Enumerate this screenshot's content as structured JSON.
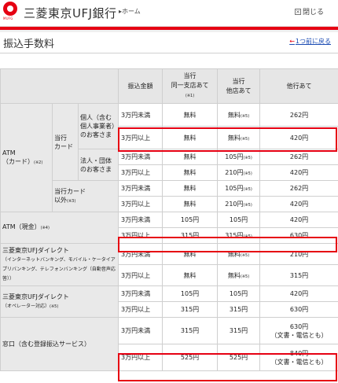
{
  "header": {
    "logo_text": "MUFG",
    "bank_name": "三菱東京UFJ銀行",
    "home_link": "▸ホーム",
    "close_icon": "×",
    "close_label": "閉じる"
  },
  "page": {
    "title": "振込手数料",
    "back_link": "1つ前に戻る"
  },
  "columns": {
    "amount": "振込金額",
    "same_branch_line1": "当行",
    "same_branch_line2": "同一支店あて",
    "same_branch_note": "(※1)",
    "other_branch_line1": "当行",
    "other_branch_line2": "他店あて",
    "other_bank": "他行あて"
  },
  "labels": {
    "atm_card": "ATM",
    "atm_card_sub": "（カード）",
    "atm_card_note": "(※2)",
    "own_card_line1": "当行",
    "own_card_line2": "カード",
    "individual": "個人（含む個人事業者）のお客さま",
    "corporate": "法人・団体のお客さま",
    "other_card_line1": "当行カード",
    "other_card_line2": "以外",
    "other_card_note": "(※3)",
    "atm_cash": "ATM（現金）",
    "atm_cash_note": "(※4)",
    "direct_title": "三菱東京UFJダイレクト",
    "direct_sub": "（インターネットバンキング、モバイル・ケータイアプリバンキング、テレフォンバンキング（自動音声応答））",
    "direct_op_title": "三菱東京UFJダイレクト",
    "direct_op_sub": "（オペレーター対応）",
    "direct_op_note": "(※5)",
    "counter": "窓口（含む登録振込サービス）"
  },
  "notes": {
    "n5": "(※5)"
  },
  "rows": [
    {
      "amount": "3万円未満",
      "same": "無料",
      "other_branch": "無料",
      "other_branch_note": "(※5)",
      "other_bank": "262円"
    },
    {
      "amount": "3万円以上",
      "same": "無料",
      "other_branch": "無料",
      "other_branch_note": "(※5)",
      "other_bank": "420円"
    },
    {
      "amount": "3万円未満",
      "same": "無料",
      "other_branch": "105円",
      "other_branch_note": "(※5)",
      "other_bank": "262円"
    },
    {
      "amount": "3万円以上",
      "same": "無料",
      "other_branch": "210円",
      "other_branch_note": "(※5)",
      "other_bank": "420円"
    },
    {
      "amount": "3万円未満",
      "same": "無料",
      "other_branch": "105円",
      "other_branch_note": "(※5)",
      "other_bank": "262円"
    },
    {
      "amount": "3万円以上",
      "same": "無料",
      "other_branch": "210円",
      "other_branch_note": "(※5)",
      "other_bank": "420円"
    },
    {
      "amount": "3万円未満",
      "same": "105円",
      "other_branch": "105円",
      "other_branch_note": "",
      "other_bank": "420円"
    },
    {
      "amount": "3万円以上",
      "same": "315円",
      "other_branch": "315円",
      "other_branch_note": "(※5)",
      "other_bank": "630円"
    },
    {
      "amount": "3万円未満",
      "same": "無料",
      "other_branch": "無料",
      "other_branch_note": "(※5)",
      "other_bank": "210円"
    },
    {
      "amount": "3万円以上",
      "same": "無料",
      "other_branch": "無料",
      "other_branch_note": "(※5)",
      "other_bank": "315円"
    },
    {
      "amount": "3万円未満",
      "same": "105円",
      "other_branch": "105円",
      "other_branch_note": "",
      "other_bank": "420円"
    },
    {
      "amount": "3万円以上",
      "same": "315円",
      "other_branch": "315円",
      "other_branch_note": "",
      "other_bank": "630円"
    },
    {
      "amount": "3万円未満",
      "same": "315円",
      "other_branch": "315円",
      "other_branch_note": "",
      "other_bank": "630円",
      "other_bank_sub": "（文書・電信とも）"
    },
    {
      "amount": "3万円以上",
      "same": "525円",
      "other_branch": "525円",
      "other_branch_note": "",
      "other_bank": "840円",
      "other_bank_sub": "（文書・電信とも）"
    }
  ],
  "colors": {
    "brand_red": "#e60012",
    "header_gray": "#e6e6e6",
    "link_blue": "#1a4bb3"
  }
}
